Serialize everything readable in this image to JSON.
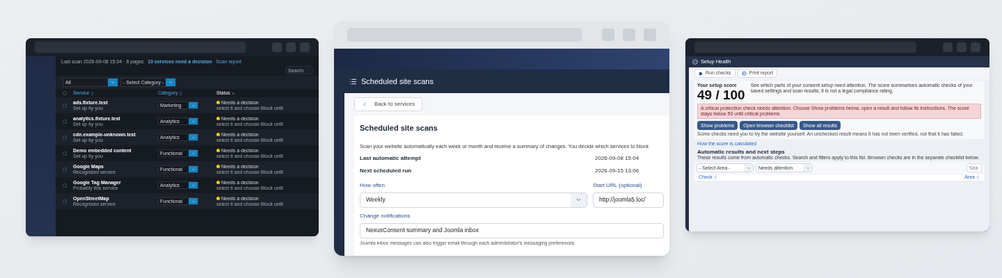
{
  "services_window": {
    "last_scan": "Last scan 2026-09-08 15:04 · 8 pages",
    "decision_link": "10 services need a decision",
    "report_link": "Scan report",
    "search_placeholder": "Search",
    "filters": [
      "All",
      "- Select Category -"
    ],
    "select_all_checked": false,
    "columns": [
      {
        "label": "Service",
        "sorted": false
      },
      {
        "label": "Category",
        "sorted": false
      },
      {
        "label": "Status",
        "sorted": true
      }
    ],
    "rows": [
      {
        "name": "ads.fixture.test",
        "source": "Set up by you",
        "category": "Marketing",
        "status": "Needs a decision",
        "hint": "select it and choose Block until",
        "checked": false
      },
      {
        "name": "analytics.fixture.test",
        "source": "Set up by you",
        "category": "Analytics",
        "status": "Needs a decision",
        "hint": "select it and choose Block until",
        "checked": false
      },
      {
        "name": "cdn.example-unknown.test",
        "source": "Set up by you",
        "category": "Analytics",
        "status": "Needs a decision",
        "hint": "select it and choose Block until",
        "checked": false
      },
      {
        "name": "Demo embedded content",
        "source": "Set up by you",
        "category": "Functional",
        "status": "Needs a decision",
        "hint": "select it and choose Block until",
        "checked": false
      },
      {
        "name": "Google Maps",
        "source": "Recognized service",
        "category": "Functional",
        "status": "Needs a decision",
        "hint": "select it and choose Block until",
        "checked": false
      },
      {
        "name": "Google Tag Manager",
        "source": "Probably this service",
        "category": "Analytics",
        "status": "Needs a decision",
        "hint": "select it and choose Block until",
        "checked": false
      },
      {
        "name": "OpenStreetMap",
        "source": "Recognized service",
        "category": "Functional",
        "status": "Needs a decision",
        "hint": "select it and choose Block until",
        "checked": false
      }
    ]
  },
  "scans_window": {
    "title": "Scheduled site scans",
    "back": "Back to services",
    "heading": "Scheduled site scans",
    "description": "Scan your website automatically each week or month and receive a summary of changes. You decide which services to block",
    "facts": [
      {
        "label": "Last automatic attempt",
        "value": "2026-09-08 15:04"
      },
      {
        "label": "Next scheduled run",
        "value": "2026-09-15 13:06"
      }
    ],
    "how_often": {
      "label": "How often",
      "value": "Weekly"
    },
    "start_url": {
      "label": "Start URL (optional)",
      "value": "http://joomla5.loc/"
    },
    "notifications": {
      "label": "Change notifications",
      "value": "NexusConsent summary and Joomla inbox"
    },
    "help": "Joomla inbox messages can also trigger email through each administrator's messaging preferences."
  },
  "health_window": {
    "title": "Setup Health",
    "toolbar": [
      {
        "label": "Run checks",
        "kind": "run"
      },
      {
        "label": "Print report",
        "kind": "print"
      }
    ],
    "score_label": "Your setup score",
    "score": "49 / 100",
    "intro": "See which parts of your consent setup need attention. The score summarises automatic checks of your saved settings and scan results; it is not a legal compliance rating.",
    "alert": "A critical protection check needs attention. Choose Show problems below, open a result and follow its instructions. The score stays below 50 until critical problems",
    "actions": [
      "Show problems",
      "Open browser checklist",
      "Show all results"
    ],
    "note": "Some checks need you to try the website yourself. An unchecked result means it has not been verified, not that it has failed.",
    "link": "How the score is calculated",
    "section_title": "Automatic results and next steps",
    "section_text": "These results come from automatic checks. Search and filters apply to this list. Browser checks are in the separate checklist below.",
    "search_placeholder": "Sea",
    "filters": [
      "- Select Area -",
      "Needs attention"
    ],
    "columns": [
      "Check",
      "Area"
    ]
  }
}
